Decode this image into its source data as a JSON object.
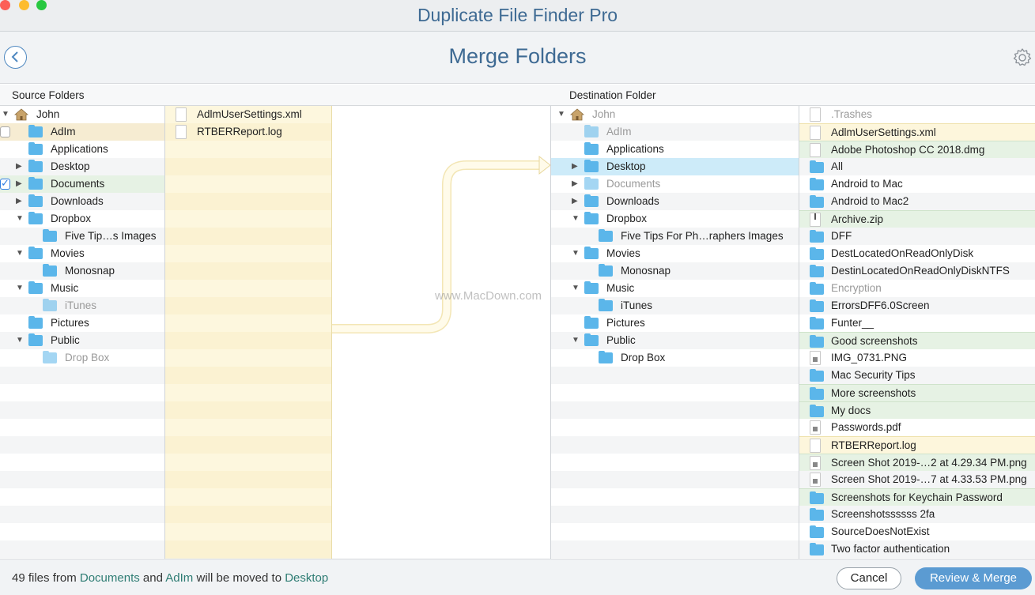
{
  "window": {
    "title": "Duplicate File Finder Pro"
  },
  "header": {
    "title": "Merge Folders"
  },
  "sections": {
    "source_label": "Source Folders",
    "destination_label": "Destination Folder"
  },
  "source_tree": [
    {
      "label": "John",
      "level": 0,
      "icon": "home-icon",
      "disclosure": "expanded",
      "state": "normal"
    },
    {
      "label": "AdIm",
      "level": 1,
      "icon": "folder-icon",
      "disclosure": "none",
      "state": "selected-yellow",
      "checkbox": "unchecked"
    },
    {
      "label": "Applications",
      "level": 1,
      "icon": "folder-icon",
      "disclosure": "none",
      "state": "normal"
    },
    {
      "label": "Desktop",
      "level": 1,
      "icon": "folder-icon",
      "disclosure": "collapsed",
      "state": "normal"
    },
    {
      "label": "Documents",
      "level": 1,
      "icon": "folder-icon",
      "disclosure": "collapsed",
      "state": "selected-green",
      "checkbox": "checked"
    },
    {
      "label": "Downloads",
      "level": 1,
      "icon": "folder-icon",
      "disclosure": "collapsed",
      "state": "normal"
    },
    {
      "label": "Dropbox",
      "level": 1,
      "icon": "folder-icon",
      "disclosure": "expanded",
      "state": "normal"
    },
    {
      "label": "Five Tip…s Images",
      "level": 2,
      "icon": "folder-icon",
      "disclosure": "none",
      "state": "normal"
    },
    {
      "label": "Movies",
      "level": 1,
      "icon": "folder-icon",
      "disclosure": "expanded",
      "state": "normal"
    },
    {
      "label": "Monosnap",
      "level": 2,
      "icon": "folder-icon",
      "disclosure": "none",
      "state": "normal"
    },
    {
      "label": "Music",
      "level": 1,
      "icon": "folder-icon",
      "disclosure": "expanded",
      "state": "normal"
    },
    {
      "label": "iTunes",
      "level": 2,
      "icon": "folder-icon",
      "disclosure": "none",
      "state": "dimmed"
    },
    {
      "label": "Pictures",
      "level": 1,
      "icon": "folder-icon",
      "disclosure": "none",
      "state": "normal"
    },
    {
      "label": "Public",
      "level": 1,
      "icon": "folder-icon",
      "disclosure": "expanded",
      "state": "normal"
    },
    {
      "label": "Drop Box",
      "level": 2,
      "icon": "folder-icon",
      "disclosure": "none",
      "state": "dimmed"
    }
  ],
  "source_files": [
    {
      "label": "AdlmUserSettings.xml",
      "icon": "file-icon"
    },
    {
      "label": "RTBERReport.log",
      "icon": "file-icon"
    }
  ],
  "destination_tree": [
    {
      "label": "John",
      "level": 0,
      "icon": "home-icon",
      "disclosure": "expanded",
      "state": "dimmed"
    },
    {
      "label": "AdIm",
      "level": 1,
      "icon": "folder-icon",
      "disclosure": "none",
      "state": "dimmed"
    },
    {
      "label": "Applications",
      "level": 1,
      "icon": "folder-icon",
      "disclosure": "none",
      "state": "normal"
    },
    {
      "label": "Desktop",
      "level": 1,
      "icon": "folder-icon",
      "disclosure": "collapsed",
      "state": "selected-blue"
    },
    {
      "label": "Documents",
      "level": 1,
      "icon": "folder-icon",
      "disclosure": "collapsed",
      "state": "dimmed"
    },
    {
      "label": "Downloads",
      "level": 1,
      "icon": "folder-icon",
      "disclosure": "collapsed",
      "state": "normal"
    },
    {
      "label": "Dropbox",
      "level": 1,
      "icon": "folder-icon",
      "disclosure": "expanded",
      "state": "normal"
    },
    {
      "label": "Five Tips For Ph…raphers Images",
      "level": 2,
      "icon": "folder-icon",
      "disclosure": "none",
      "state": "normal"
    },
    {
      "label": "Movies",
      "level": 1,
      "icon": "folder-icon",
      "disclosure": "expanded",
      "state": "normal"
    },
    {
      "label": "Monosnap",
      "level": 2,
      "icon": "folder-icon",
      "disclosure": "none",
      "state": "normal"
    },
    {
      "label": "Music",
      "level": 1,
      "icon": "folder-icon",
      "disclosure": "expanded",
      "state": "normal"
    },
    {
      "label": "iTunes",
      "level": 2,
      "icon": "folder-icon",
      "disclosure": "none",
      "state": "normal"
    },
    {
      "label": "Pictures",
      "level": 1,
      "icon": "folder-icon",
      "disclosure": "none",
      "state": "normal"
    },
    {
      "label": "Public",
      "level": 1,
      "icon": "folder-icon",
      "disclosure": "expanded",
      "state": "normal"
    },
    {
      "label": "Drop Box",
      "level": 2,
      "icon": "folder-icon",
      "disclosure": "none",
      "state": "normal"
    }
  ],
  "destination_files": [
    {
      "label": ".Trashes",
      "icon": "file-icon",
      "state": "dimmed"
    },
    {
      "label": "AdlmUserSettings.xml",
      "icon": "file-icon",
      "state": "yellow"
    },
    {
      "label": "Adobe Photoshop CC 2018.dmg",
      "icon": "file-icon",
      "state": "green"
    },
    {
      "label": "All",
      "icon": "folder-icon",
      "state": "normal"
    },
    {
      "label": "Android to Mac",
      "icon": "folder-icon",
      "state": "normal"
    },
    {
      "label": "Android to Mac2",
      "icon": "folder-icon",
      "state": "normal"
    },
    {
      "label": "Archive.zip",
      "icon": "zip-icon",
      "state": "green"
    },
    {
      "label": "DFF",
      "icon": "folder-icon",
      "state": "normal"
    },
    {
      "label": "DestLocatedOnReadOnlyDisk",
      "icon": "folder-icon",
      "state": "normal"
    },
    {
      "label": "DestinLocatedOnReadOnlyDiskNTFS",
      "icon": "folder-icon",
      "state": "normal"
    },
    {
      "label": "Encryption",
      "icon": "folder-icon",
      "state": "dimmed"
    },
    {
      "label": "ErrorsDFF6.0Screen",
      "icon": "folder-icon",
      "state": "normal"
    },
    {
      "label": "Funter__",
      "icon": "folder-icon",
      "state": "normal"
    },
    {
      "label": "Good screenshots",
      "icon": "folder-icon",
      "state": "green"
    },
    {
      "label": "IMG_0731.PNG",
      "icon": "image-icon",
      "state": "normal"
    },
    {
      "label": "Mac Security Tips",
      "icon": "folder-icon",
      "state": "normal"
    },
    {
      "label": "More screenshots",
      "icon": "folder-icon",
      "state": "green"
    },
    {
      "label": "My docs",
      "icon": "folder-icon",
      "state": "green"
    },
    {
      "label": "Passwords.pdf",
      "icon": "image-icon",
      "state": "normal"
    },
    {
      "label": "RTBERReport.log",
      "icon": "file-icon",
      "state": "yellow"
    },
    {
      "label": "Screen Shot 2019-…2 at 4.29.34 PM.png",
      "icon": "image-icon",
      "state": "green"
    },
    {
      "label": "Screen Shot 2019-…7 at 4.33.53 PM.png",
      "icon": "image-icon",
      "state": "normal"
    },
    {
      "label": "Screenshots for Keychain Password",
      "icon": "folder-icon",
      "state": "green"
    },
    {
      "label": "Screenshotssssss 2fa",
      "icon": "folder-icon",
      "state": "normal"
    },
    {
      "label": "SourceDoesNotExist",
      "icon": "folder-icon",
      "state": "normal"
    },
    {
      "label": "Two factor authentication",
      "icon": "folder-icon",
      "state": "normal"
    }
  ],
  "footer": {
    "msg_prefix": "49 files from",
    "msg_source1": "Documents",
    "msg_and": "and",
    "msg_source2": "AdIm",
    "msg_middle": "will be moved to",
    "msg_dest": "Desktop",
    "cancel_label": "Cancel",
    "merge_label": "Review & Merge"
  },
  "watermark": "www.MacDown.com",
  "colors": {
    "accent": "#3e6a93",
    "folder": "#5bb6ea",
    "row_green": "#e6f2e4",
    "row_yellow": "#fdf6dc",
    "row_blue": "#cdebf9",
    "merge_button": "#5b9bd2"
  }
}
